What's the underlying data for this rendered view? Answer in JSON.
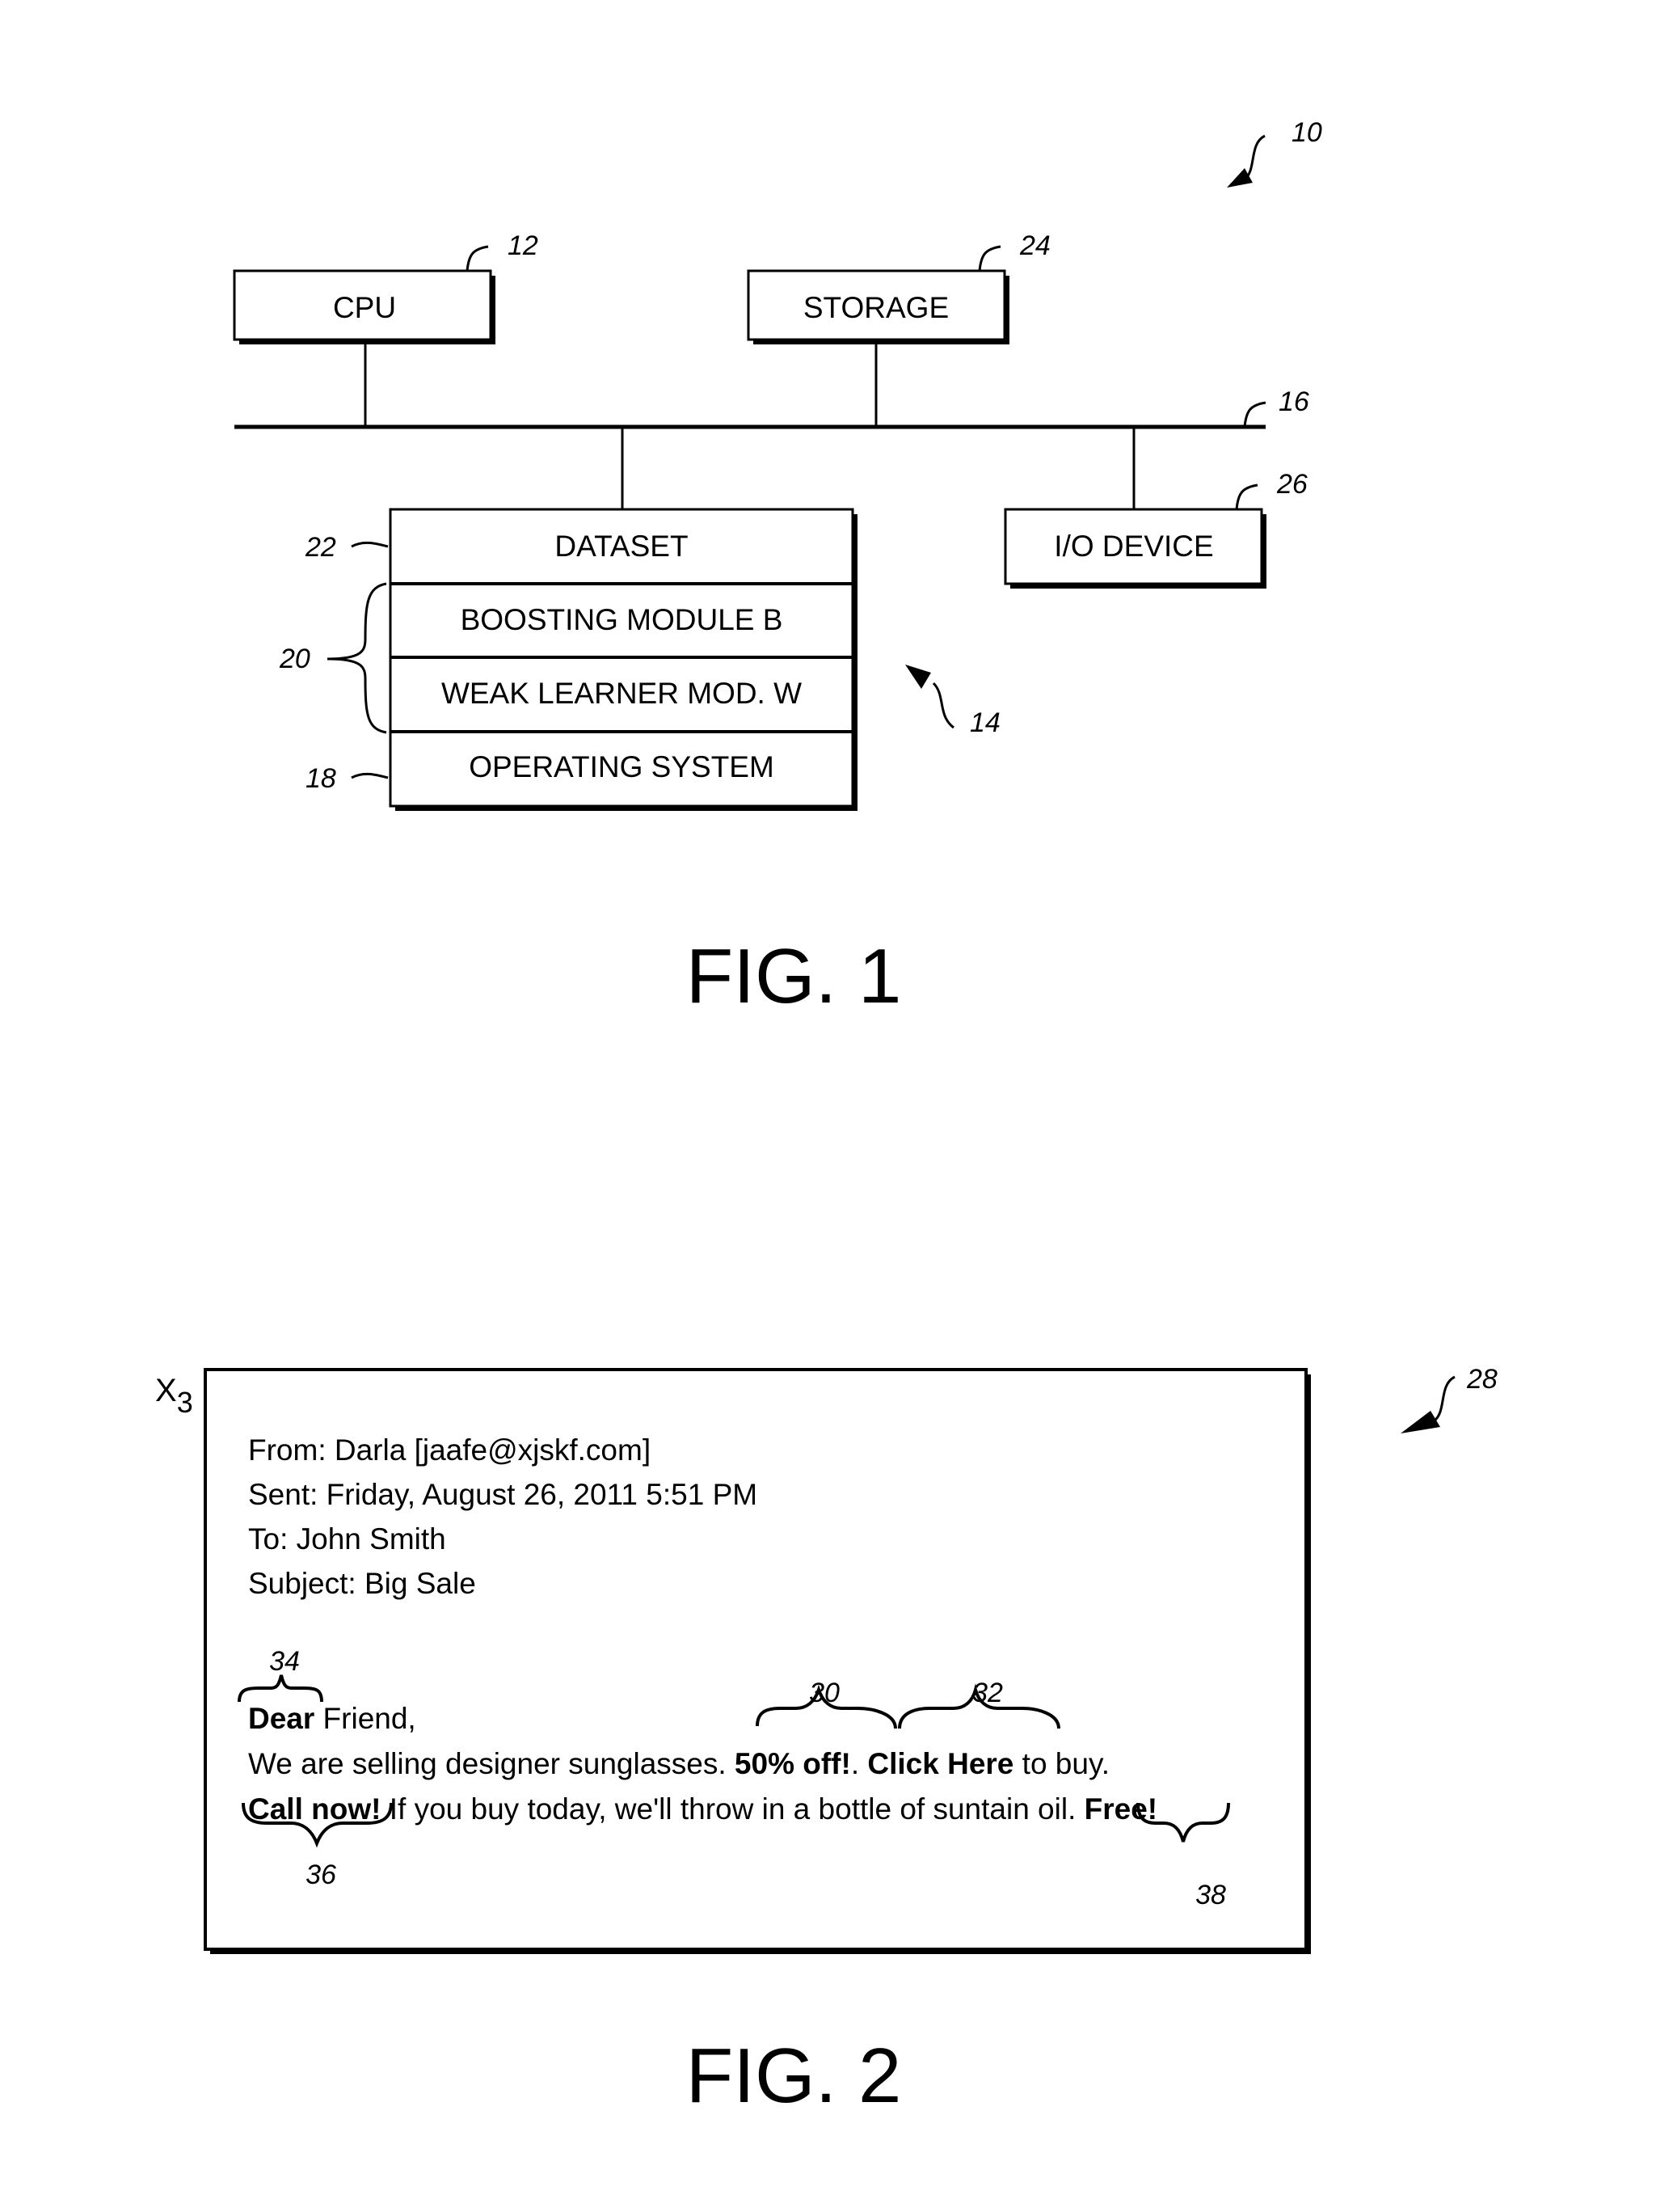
{
  "fig1": {
    "caption": "FIG. 1",
    "system_ref": "10",
    "cpu": {
      "label": "CPU",
      "ref": "12"
    },
    "storage": {
      "label": "STORAGE",
      "ref": "24"
    },
    "bus": {
      "ref": "16"
    },
    "io_device": {
      "label": "I/O DEVICE",
      "ref": "26"
    },
    "memory": {
      "ref": "14",
      "rows": [
        {
          "label": "DATASET",
          "ref": "22"
        },
        {
          "label": "BOOSTING MODULE B"
        },
        {
          "label": "WEAK LEARNER MOD. W"
        },
        {
          "label": "OPERATING SYSTEM",
          "ref": "18"
        }
      ],
      "brace_ref": "20"
    }
  },
  "fig2": {
    "caption": "FIG. 2",
    "ref": "28",
    "doc_label": "X",
    "doc_label_sub": "3",
    "email": {
      "from": "From: Darla [jaafe@xjskf.com]",
      "sent": "Sent: Friday, August 26, 2011 5:51 PM",
      "to": "To: John Smith",
      "subject": "Subject: Big Sale",
      "greeting_bold": "Dear",
      "greeting_rest": " Friend,",
      "line1_a": "We are selling designer sunglasses. ",
      "line1_bold1": "50% off!",
      "line1_b": ". ",
      "line1_bold2": "Click Here",
      "line1_c": " to buy.",
      "line2_bold1": "Call now!",
      "line2_a": " If you buy today, we'll throw in a bottle of suntain oil. ",
      "line2_bold2": "Free!"
    },
    "annotations": {
      "dear": "34",
      "off": "30",
      "click": "32",
      "call": "36",
      "free": "38"
    }
  }
}
